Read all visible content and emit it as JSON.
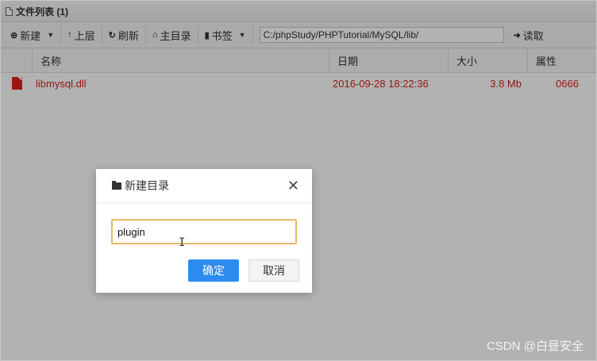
{
  "window": {
    "title": "文件列表 (1)"
  },
  "toolbar": {
    "new_label": "新建",
    "up_label": "上层",
    "refresh_label": "刷新",
    "home_label": "主目录",
    "bookmark_label": "书签",
    "path_value": "C:/phpStudy/PHPTutorial/MySQL/lib/",
    "read_label": "读取"
  },
  "table": {
    "columns": [
      "名称",
      "日期",
      "大小",
      "属性"
    ],
    "rows": [
      {
        "name": "libmysql.dll",
        "date": "2016-09-28 18:22:36",
        "size": "3.8 Mb",
        "attr": "0666"
      }
    ]
  },
  "dialog": {
    "title": "新建目录",
    "input_value": "plugin",
    "ok_label": "确定",
    "cancel_label": "取消"
  },
  "watermark": "CSDN @白昼安全",
  "colors": {
    "accent": "#2d8cf0",
    "file_red": "#d9231a",
    "input_focus": "#e8b866"
  }
}
